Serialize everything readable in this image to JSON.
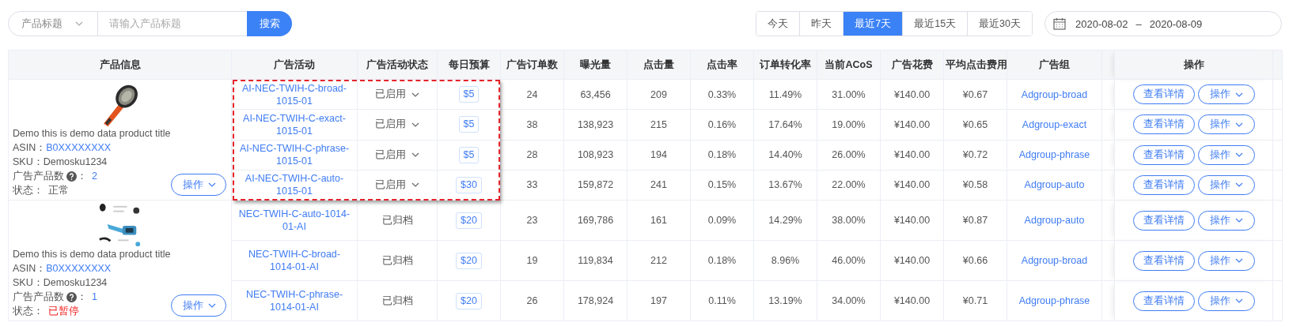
{
  "search": {
    "field": "产品标题",
    "placeholder": "请输入产品标题",
    "button": "搜索"
  },
  "date_ranges": [
    {
      "label": "今天",
      "selected": false
    },
    {
      "label": "昨天",
      "selected": false
    },
    {
      "label": "最近7天",
      "selected": true
    },
    {
      "label": "最近15天",
      "selected": false
    },
    {
      "label": "最近30天",
      "selected": false
    }
  ],
  "date_picker": {
    "start": "2020-08-02",
    "separator": "–",
    "end": "2020-08-09"
  },
  "table": {
    "columns": [
      "产品信息",
      "广告活动",
      "广告活动状态",
      "每日预算",
      "广告订单数",
      "曝光量",
      "点击量",
      "点击率",
      "订单转化率",
      "当前ACoS",
      "广告花费",
      "平均点击费用",
      "广告组",
      "操作"
    ],
    "groups": [
      {
        "highlighted": true,
        "product": {
          "title": "Demo this is demo data product title",
          "asin_label": "ASIN：",
          "asin": "B0XXXXXXXX",
          "sku": "SKU：Demosku1234",
          "count_label": "广告产品数",
          "count_colon": "：",
          "count": "2",
          "status_label": "状态：",
          "status": "正常",
          "paused": false,
          "action": "操作"
        },
        "rows": [
          {
            "campaign": "AI-NEC-TWIH-C-broad-1015-01",
            "status": {
              "text": "已启用",
              "kind": "dropdown"
            },
            "budget": "$5",
            "orders": "24",
            "impressions": "63,456",
            "clicks": "209",
            "ctr": "0.33%",
            "cvr": "11.49%",
            "acos": "31.00%",
            "spend": "¥140.00",
            "cpc": "¥0.67",
            "adgroup": "Adgroup-broad",
            "actions": [
              {
                "label": "查看详情",
                "kind": "button"
              },
              {
                "label": "操作",
                "kind": "menu"
              }
            ]
          },
          {
            "campaign": "AI-NEC-TWIH-C-exact-1015-01",
            "status": {
              "text": "已启用",
              "kind": "dropdown"
            },
            "budget": "$5",
            "orders": "38",
            "impressions": "138,923",
            "clicks": "215",
            "ctr": "0.16%",
            "cvr": "17.64%",
            "acos": "19.00%",
            "spend": "¥140.00",
            "cpc": "¥0.65",
            "adgroup": "Adgroup-exact",
            "actions": [
              {
                "label": "查看详情",
                "kind": "button"
              },
              {
                "label": "操作",
                "kind": "menu"
              }
            ]
          },
          {
            "campaign": "AI-NEC-TWIH-C-phrase-1015-01",
            "status": {
              "text": "已启用",
              "kind": "dropdown"
            },
            "budget": "$5",
            "orders": "28",
            "impressions": "108,923",
            "clicks": "194",
            "ctr": "0.18%",
            "cvr": "14.40%",
            "acos": "26.00%",
            "spend": "¥140.00",
            "cpc": "¥0.72",
            "adgroup": "Adgroup-phrase",
            "actions": [
              {
                "label": "查看详情",
                "kind": "button"
              },
              {
                "label": "操作",
                "kind": "menu"
              }
            ]
          },
          {
            "campaign": "AI-NEC-TWIH-C-auto-1015-01",
            "status": {
              "text": "已启用",
              "kind": "dropdown"
            },
            "budget": "$30",
            "orders": "33",
            "impressions": "159,872",
            "clicks": "241",
            "ctr": "0.15%",
            "cvr": "13.67%",
            "acos": "22.00%",
            "spend": "¥140.00",
            "cpc": "¥0.58",
            "adgroup": "Adgroup-auto",
            "actions": [
              {
                "label": "查看详情",
                "kind": "button"
              },
              {
                "label": "操作",
                "kind": "menu"
              }
            ]
          }
        ]
      },
      {
        "highlighted": false,
        "product": {
          "title": "Demo this is demo data product title",
          "asin_label": "ASIN：",
          "asin": "B0XXXXXXXX",
          "sku": "SKU：Demosku1234",
          "count_label": "广告产品数",
          "count_colon": "：",
          "count": "1",
          "status_label": "状态：",
          "status": "已暂停",
          "paused": true,
          "action": "操作"
        },
        "rows": [
          {
            "campaign": "NEC-TWIH-C-auto-1014-01-AI",
            "status": {
              "text": "已归档",
              "kind": "text"
            },
            "budget": "$20",
            "orders": "23",
            "impressions": "169,786",
            "clicks": "161",
            "ctr": "0.09%",
            "cvr": "14.29%",
            "acos": "38.00%",
            "spend": "¥140.00",
            "cpc": "¥0.87",
            "adgroup": "Adgroup-auto",
            "actions": [
              {
                "label": "查看详情",
                "kind": "button"
              },
              {
                "label": "操作",
                "kind": "menu"
              }
            ]
          },
          {
            "campaign": "NEC-TWIH-C-broad-1014-01-AI",
            "status": {
              "text": "已归档",
              "kind": "text"
            },
            "budget": "$20",
            "orders": "19",
            "impressions": "119,834",
            "clicks": "212",
            "ctr": "0.18%",
            "cvr": "8.96%",
            "acos": "46.00%",
            "spend": "¥140.00",
            "cpc": "¥0.66",
            "adgroup": "Adgroup-broad",
            "actions": [
              {
                "label": "查看详情",
                "kind": "button"
              },
              {
                "label": "操作",
                "kind": "menu"
              }
            ]
          },
          {
            "campaign": "NEC-TWIH-C-phrase-1014-01-AI",
            "status": {
              "text": "已归档",
              "kind": "text"
            },
            "budget": "$20",
            "orders": "26",
            "impressions": "178,924",
            "clicks": "197",
            "ctr": "0.11%",
            "cvr": "13.19%",
            "acos": "34.00%",
            "spend": "¥140.00",
            "cpc": "¥0.71",
            "adgroup": "Adgroup-phrase",
            "actions": [
              {
                "label": "查看详情",
                "kind": "button"
              },
              {
                "label": "操作",
                "kind": "menu"
              }
            ]
          }
        ]
      }
    ]
  }
}
